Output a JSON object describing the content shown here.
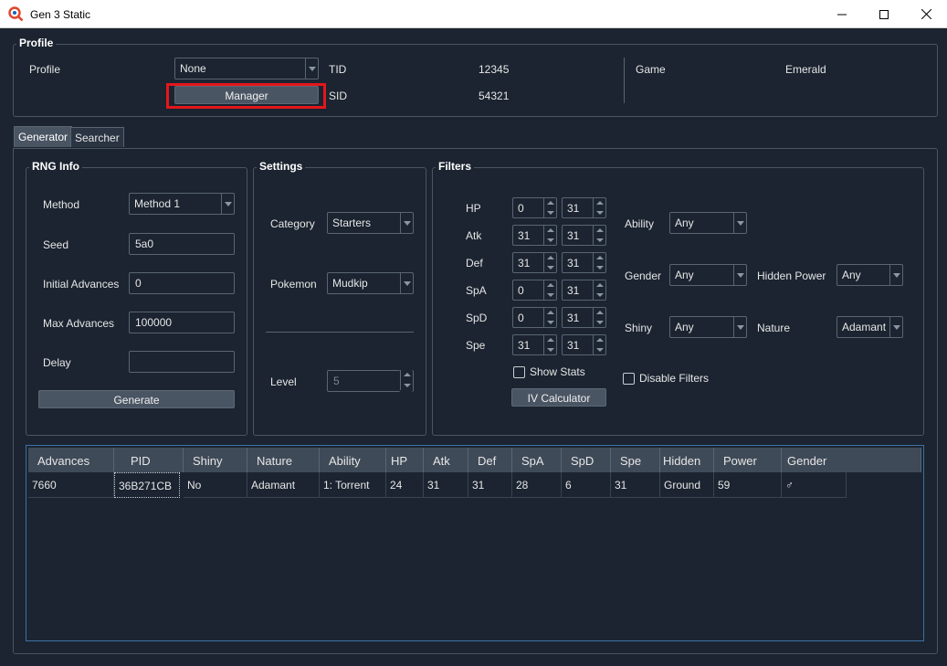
{
  "window": {
    "title": "Gen 3 Static",
    "minimize": "—",
    "maximize": "☐",
    "close": "✕"
  },
  "profile": {
    "section_title": "Profile",
    "profile_label": "Profile",
    "profile_value": "None",
    "manager_button": "Manager",
    "tid_label": "TID",
    "tid_value": "12345",
    "sid_label": "SID",
    "sid_value": "54321",
    "game_label": "Game",
    "game_value": "Emerald"
  },
  "tabs": [
    {
      "label": "Generator"
    },
    {
      "label": "Searcher"
    }
  ],
  "rng_info": {
    "section_title": "RNG Info",
    "method_label": "Method",
    "method_value": "Method 1",
    "seed_label": "Seed",
    "seed_value": "5a0",
    "initial_advances_label": "Initial Advances",
    "initial_advances_value": "0",
    "max_advances_label": "Max Advances",
    "max_advances_value": "100000",
    "delay_label": "Delay",
    "delay_value": "",
    "generate_button": "Generate"
  },
  "settings": {
    "section_title": "Settings",
    "category_label": "Category",
    "category_value": "Starters",
    "pokemon_label": "Pokemon",
    "pokemon_value": "Mudkip",
    "level_label": "Level",
    "level_value": "5"
  },
  "filters": {
    "section_title": "Filters",
    "ivs": [
      {
        "label": "HP",
        "min": "0",
        "max": "31"
      },
      {
        "label": "Atk",
        "min": "31",
        "max": "31"
      },
      {
        "label": "Def",
        "min": "31",
        "max": "31"
      },
      {
        "label": "SpA",
        "min": "0",
        "max": "31"
      },
      {
        "label": "SpD",
        "min": "0",
        "max": "31"
      },
      {
        "label": "Spe",
        "min": "31",
        "max": "31"
      }
    ],
    "show_stats_label": "Show Stats",
    "iv_calculator_button": "IV Calculator",
    "ability_label": "Ability",
    "ability_value": "Any",
    "gender_label": "Gender",
    "gender_value": "Any",
    "hidden_power_label": "Hidden Power",
    "hidden_power_value": "Any",
    "shiny_label": "Shiny",
    "shiny_value": "Any",
    "nature_label": "Nature",
    "nature_value": "Adamant",
    "disable_filters_label": "Disable Filters"
  },
  "results": {
    "columns": [
      "Advances",
      "PID",
      "Shiny",
      "Nature",
      "Ability",
      "HP",
      "Atk",
      "Def",
      "SpA",
      "SpD",
      "Spe",
      "Hidden",
      "Power",
      "Gender"
    ],
    "rows": [
      [
        "7660",
        "36B271CB",
        "No",
        "Adamant",
        "1: Torrent",
        "24",
        "31",
        "31",
        "28",
        "6",
        "31",
        "Ground",
        "59",
        "♂"
      ]
    ]
  },
  "colors": {
    "background": "#1b2430",
    "accent_border": "#3f6fa6",
    "highlight": "#e4161b",
    "button": "#4a5563"
  },
  "icons": {
    "app": "magnifier-pokeball-icon",
    "dropdown": "chevron-down-icon"
  }
}
